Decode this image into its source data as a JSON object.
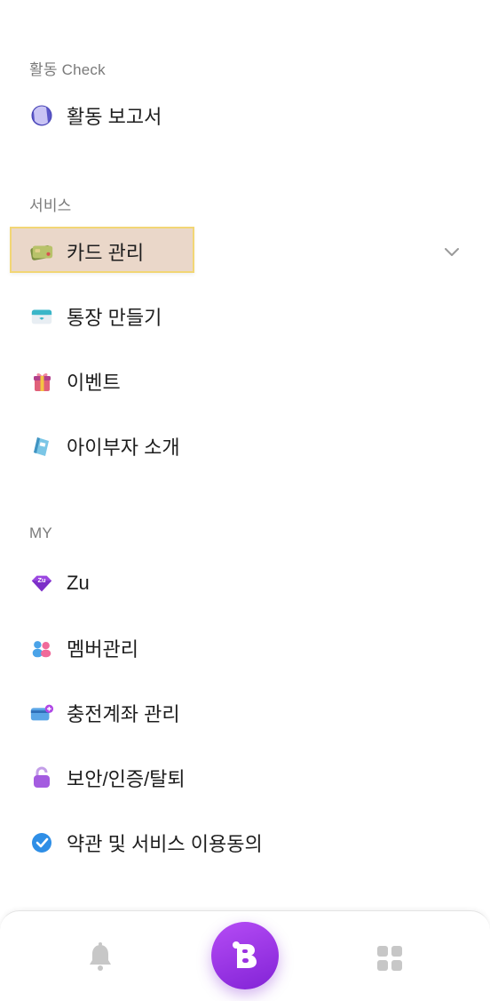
{
  "sections": {
    "activity": {
      "label": "활동 Check",
      "items": [
        {
          "label": "활동 보고서",
          "icon": "activity-report-icon"
        }
      ]
    },
    "service": {
      "label": "서비스",
      "items": [
        {
          "label": "카드 관리",
          "icon": "card-icon",
          "highlighted": true,
          "expandable": true
        },
        {
          "label": "통장 만들기",
          "icon": "bankbook-icon"
        },
        {
          "label": "이벤트",
          "icon": "gift-icon"
        },
        {
          "label": "아이부자 소개",
          "icon": "book-icon"
        }
      ]
    },
    "my": {
      "label": "MY",
      "items": [
        {
          "label": "Zu",
          "icon": "zu-gem-icon"
        },
        {
          "label": "멤버관리",
          "icon": "members-icon"
        },
        {
          "label": "충전계좌 관리",
          "icon": "charge-account-icon"
        },
        {
          "label": "보안/인증/탈퇴",
          "icon": "lock-icon"
        },
        {
          "label": "약관 및 서비스 이용동의",
          "icon": "check-circle-icon"
        }
      ]
    }
  },
  "bottom_nav": {
    "items": [
      {
        "icon": "bell-icon"
      },
      {
        "icon": "brand-b-icon"
      },
      {
        "icon": "apps-grid-icon"
      }
    ]
  },
  "colors": {
    "highlight_bg": "#ead7c9",
    "highlight_border": "#f2d675",
    "brand_purple": "#9b34e8"
  }
}
